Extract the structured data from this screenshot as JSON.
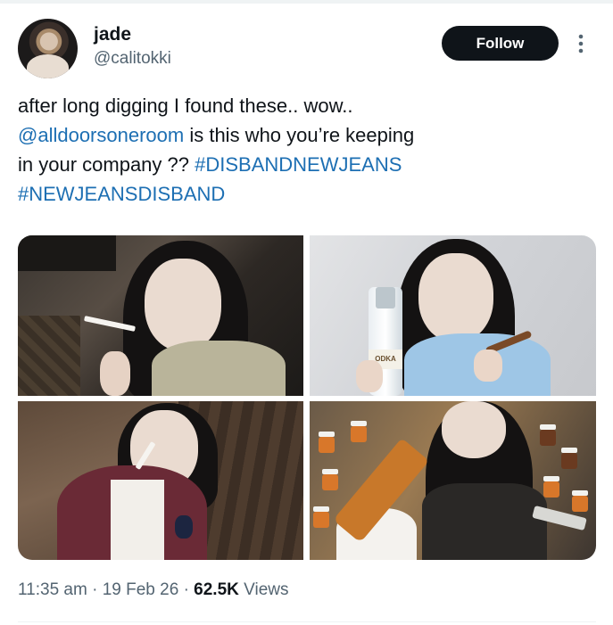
{
  "author": {
    "display_name": "jade",
    "handle": "@calitokki"
  },
  "actions": {
    "follow_label": "Follow"
  },
  "tweet": {
    "text_line1": "after long digging I found these.. wow..",
    "mention": "@alldoorsoneroom",
    "text_line2_rest": " is this who you’re keeping",
    "text_line3": "in your company ?? ",
    "hashtag1": "#DISBANDNEWJEANS",
    "hashtag2": "#NEWJEANSDISBAND"
  },
  "media": {
    "photo_count": 4,
    "bottle_label": "ODKA"
  },
  "meta": {
    "time": "11:35 am",
    "separator": "·",
    "date": "19 Feb 26",
    "views_count": "62.5K",
    "views_label": "Views"
  },
  "colors": {
    "text": "#0f1419",
    "secondary": "#536471",
    "link": "#1d6fb3",
    "follow_bg": "#0f1419"
  },
  "icons": {
    "more": "more-vertical-icon"
  }
}
